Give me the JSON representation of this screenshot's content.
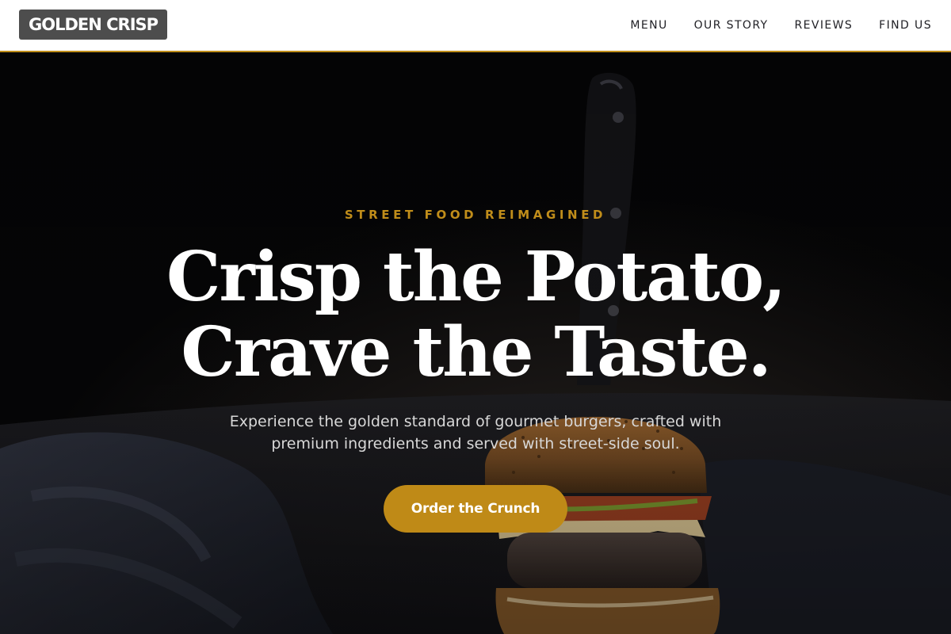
{
  "header": {
    "logo_text": "GOLDEN CRISP",
    "nav": [
      {
        "label": "MENU"
      },
      {
        "label": "OUR STORY"
      },
      {
        "label": "REVIEWS"
      },
      {
        "label": "FIND US"
      }
    ]
  },
  "hero": {
    "eyebrow": "STREET FOOD REIMAGINED",
    "headline_line1": "Crisp the Potato,",
    "headline_line2": "Crave the Taste.",
    "sub_line1": "Experience the golden standard of gourmet burgers, crafted with",
    "sub_line2": "premium ingredients and served with street-side soul.",
    "cta_label": "Order the Crunch"
  },
  "colors": {
    "accent": "#c08d1a",
    "header_bg": "#ffffff",
    "logo_bg": "#4d4d4d",
    "hero_bg": "#050506"
  }
}
